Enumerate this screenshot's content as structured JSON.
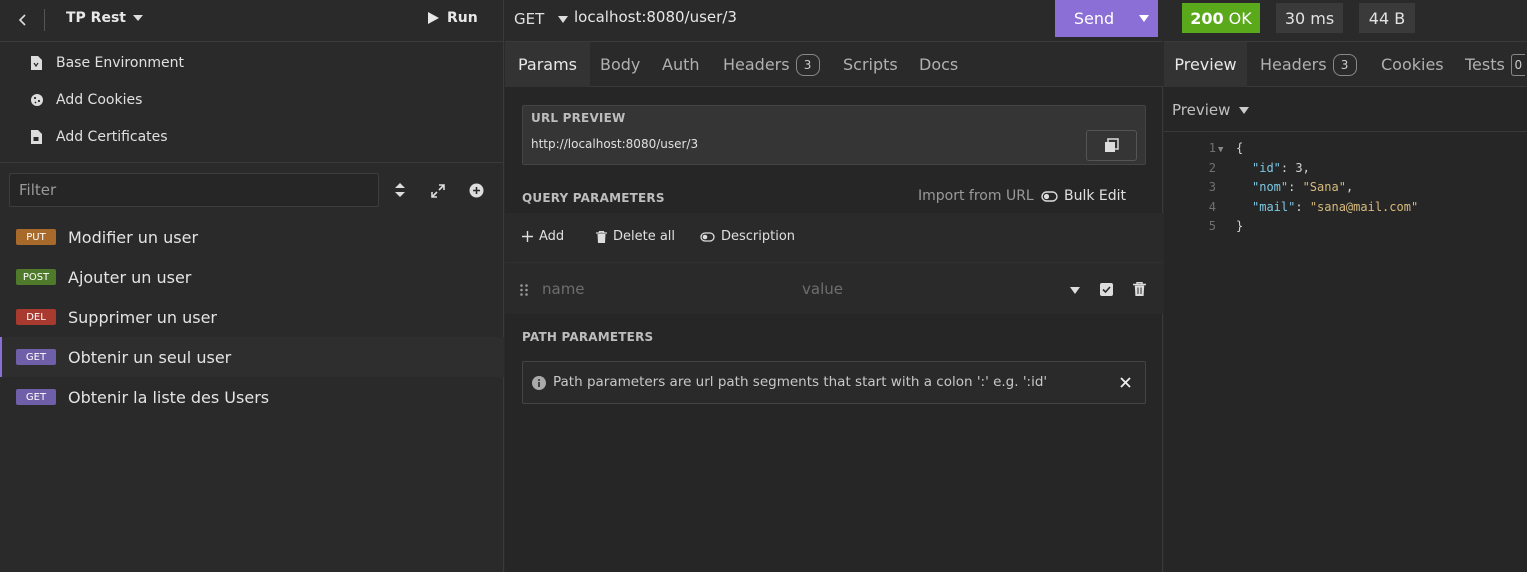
{
  "sidebar": {
    "project_name": "TP Rest",
    "run_label": "Run",
    "nav": [
      {
        "label": "Base Environment",
        "icon": "file-icon"
      },
      {
        "label": "Add Cookies",
        "icon": "cookie-icon"
      },
      {
        "label": "Add Certificates",
        "icon": "certificate-icon"
      }
    ],
    "filter_placeholder": "Filter",
    "requests": [
      {
        "method": "PUT",
        "name": "Modifier un user",
        "color": "#a86a2b"
      },
      {
        "method": "POST",
        "name": "Ajouter un user",
        "color": "#4f7a2c"
      },
      {
        "method": "DEL",
        "name": "Supprimer un user",
        "color": "#a83a2f"
      },
      {
        "method": "GET",
        "name": "Obtenir un seul user",
        "color": "#6f5fa8"
      },
      {
        "method": "GET",
        "name": "Obtenir la liste des Users",
        "color": "#6f5fa8"
      }
    ]
  },
  "request": {
    "method": "GET",
    "url": "localhost:8080/user/3",
    "send_label": "Send",
    "tabs": [
      {
        "label": "Params"
      },
      {
        "label": "Body"
      },
      {
        "label": "Auth"
      },
      {
        "label": "Headers",
        "count": "3"
      },
      {
        "label": "Scripts"
      },
      {
        "label": "Docs"
      }
    ],
    "url_preview_title": "URL PREVIEW",
    "url_preview_value": "http://localhost:8080/user/3",
    "query_title": "QUERY PARAMETERS",
    "import_label": "Import from URL",
    "bulk_edit_label": "Bulk Edit",
    "add_label": "Add",
    "delete_all_label": "Delete all",
    "description_label": "Description",
    "name_placeholder": "name",
    "value_placeholder": "value",
    "path_title": "PATH PARAMETERS",
    "path_info": "Path parameters are url path segments that start with a colon ':' e.g. ':id'"
  },
  "response": {
    "status": "200",
    "status_text": "OK",
    "time": "30 ms",
    "size": "44 B",
    "tabs": [
      {
        "label": "Preview"
      },
      {
        "label": "Headers",
        "count": "3"
      },
      {
        "label": "Cookies"
      },
      {
        "label": "Tests",
        "count": "0"
      }
    ],
    "preview_mode": "Preview",
    "lines": [
      {
        "n": "1",
        "text": "{"
      },
      {
        "n": "2",
        "key": "\"id\"",
        "value": "3",
        "type": "num"
      },
      {
        "n": "3",
        "key": "\"nom\"",
        "value": "\"Sana\"",
        "type": "str"
      },
      {
        "n": "4",
        "key": "\"mail\"",
        "value": "\"sana@mail.com\"",
        "type": "str",
        "last": true
      },
      {
        "n": "5",
        "text": "}"
      }
    ]
  },
  "colors": {
    "accent": "#8b6fd6",
    "status_ok": "#59a91a"
  }
}
